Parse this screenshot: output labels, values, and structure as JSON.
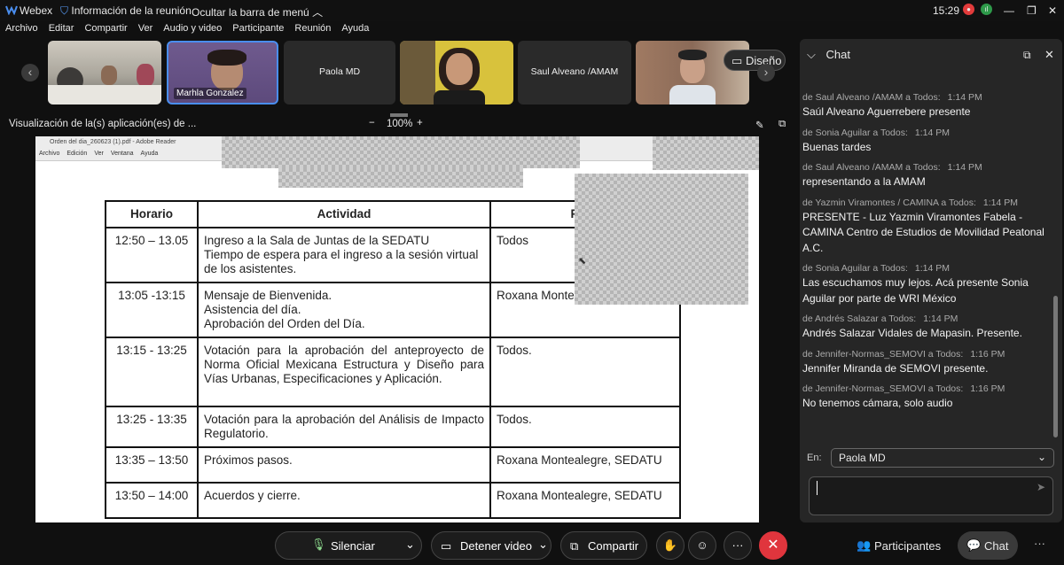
{
  "titlebar": {
    "app_name": "Webex",
    "meeting_info": "Información de la reunión",
    "hide_menu": "Ocultar la barra de menú",
    "time": "15:29",
    "rec_indicator": "record-icon",
    "signal_indicator": "signal-icon"
  },
  "menu": [
    "Archivo",
    "Editar",
    "Compartir",
    "Ver",
    "Audio y video",
    "Participante",
    "Reunión",
    "Ayuda"
  ],
  "videos": {
    "tile2_label": "Marhla Gonzalez",
    "tile3_name": "Paola MD",
    "tile5_name": "Saul Alveano /AMAM",
    "layout_button": "Diseño"
  },
  "share": {
    "title": "Visualización de la(s) aplicación(es) de ...",
    "zoom": "100%",
    "zoom_out": "−",
    "zoom_in": "+"
  },
  "document": {
    "reader_title": "Orden del dia_260623 (1).pdf - Adobe Reader",
    "reader_menu": [
      "Archivo",
      "Edición",
      "Ver",
      "Ventana",
      "Ayuda"
    ],
    "headers": [
      "Horario",
      "Actividad",
      "Resp"
    ],
    "rows": [
      {
        "time": "12:50 – 13.05",
        "activity": [
          "Ingreso a la Sala de Juntas de la SEDATU",
          "Tiempo de espera para el ingreso a la sesión virtual de los asistentes."
        ],
        "resp": "Todos"
      },
      {
        "time": "13:05 -13:15",
        "activity": [
          "Mensaje de Bienvenida.",
          "Asistencia del día.",
          "Aprobación del Orden del Día."
        ],
        "resp": "Roxana Monte"
      },
      {
        "time": "13:15 - 13:25",
        "activity": [
          "Votación para la aprobación del anteproyecto de Norma Oficial Mexicana Estructura y Diseño para Vías Urbanas, Especificaciones y Aplicación."
        ],
        "resp": "Todos."
      },
      {
        "time": "13:25 - 13:35",
        "activity": [
          "Votación para la aprobación del Análisis de Impacto Regulatorio."
        ],
        "resp": "Todos."
      },
      {
        "time": "13:35 – 13:50",
        "activity": [
          "Próximos pasos."
        ],
        "resp": "Roxana Montealegre, SEDATU"
      },
      {
        "time": "13:50 – 14:00",
        "activity": [
          "Acuerdos y cierre."
        ],
        "resp": "Roxana Montealegre, SEDATU"
      }
    ]
  },
  "chat": {
    "title": "Chat",
    "messages": [
      {
        "from": "de Saul Alveano /AMAM a Todos:",
        "time": "1:14 PM",
        "text": "Saúl Alveano Aguerrebere presente"
      },
      {
        "from": "de Sonia Aguilar a Todos:",
        "time": "1:14 PM",
        "text": "Buenas tardes"
      },
      {
        "from": "de Saul Alveano /AMAM a Todos:",
        "time": "1:14 PM",
        "text": "representando a la AMAM"
      },
      {
        "from": "de Yazmin Viramontes / CAMINA a Todos:",
        "time": "1:14 PM",
        "text": "PRESENTE  - Luz Yazmin Viramontes Fabela - CAMINA Centro de Estudios de Movilidad Peatonal A.C."
      },
      {
        "from": "de Sonia Aguilar a Todos:",
        "time": "1:14 PM",
        "text": "Las escuchamos muy lejos. Acá presente Sonia Aguilar por parte de WRI México"
      },
      {
        "from": "de Andrés Salazar a Todos:",
        "time": "1:14 PM",
        "text": "Andrés Salazar Vidales de Mapasin. Presente."
      },
      {
        "from": "de Jennifer-Normas_SEMOVI a Todos:",
        "time": "1:16 PM",
        "text": "Jennifer Miranda de SEMOVI presente."
      },
      {
        "from": "de Jennifer-Normas_SEMOVI a Todos:",
        "time": "1:16 PM",
        "text": "No tenemos cámara, solo audio"
      }
    ],
    "to_label": "En:",
    "to_value": "Paola MD"
  },
  "toolbar": {
    "mute": "Silenciar",
    "stop_video": "Detener video",
    "share": "Compartir",
    "participants": "Participantes",
    "chat": "Chat",
    "more": "···"
  },
  "colors": {
    "accent_blue": "#4a8ef0",
    "leave_red": "#e0353d",
    "rec_red": "#e23b3b",
    "panel_bg": "#262626"
  }
}
